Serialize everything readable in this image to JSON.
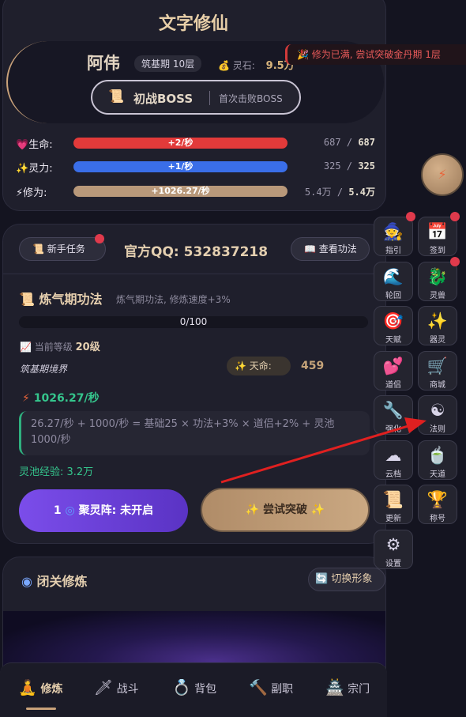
{
  "app_title": "文字修仙",
  "player": {
    "name": "阿伟",
    "realm": "筑基期 10层",
    "spirit_stone_label": "灵石:",
    "spirit_stone_value": "9.5万"
  },
  "boss_button": {
    "label": "初战BOSS",
    "desc": "首次击败BOSS"
  },
  "stats": [
    {
      "icon": "heart-icon",
      "label": "生命:",
      "rate": "+2/秒",
      "current": "687",
      "sep": "/",
      "max": "687",
      "color": "#e23a3a",
      "fill": 1.0
    },
    {
      "icon": "sparkle-icon",
      "label": "灵力:",
      "rate": "+1/秒",
      "current": "325",
      "sep": "/",
      "max": "325",
      "color": "#3a6ee8",
      "fill": 1.0
    },
    {
      "icon": "lightning-icon",
      "label": "修为:",
      "rate": "+1026.27/秒",
      "current": "5.4万",
      "sep": "/",
      "max": "5.4万",
      "color": "#b8987a",
      "fill": 1.0
    }
  ],
  "main": {
    "newbie_task": "新手任务",
    "qq_label": "官方QQ:",
    "qq_number": "532837218",
    "view_method": "查看功法",
    "method_title": "炼气期功法",
    "method_sub": "炼气期功法, 修炼速度+3%",
    "exp_text": "0/100",
    "current_level_label": "当前等级",
    "current_level_value": "20级",
    "realm_state": "筑基期境界",
    "fate_label": "天命:",
    "fate_value": "459",
    "speed": "1026.27/秒",
    "formula": "26.27/秒 + 1000/秒 = 基础25 × 功法+3% × 道侣+2% + 灵池1000/秒",
    "pool_exp": "灵池经验: 3.2万",
    "gather_count": "1",
    "gather_label": "聚灵阵: 未开启",
    "breakthrough_label": "尝试突破"
  },
  "seclusion": {
    "title": "闭关修炼",
    "swap_label": "切换形象"
  },
  "notice": "修为已满, 尝试突破金丹期 1层",
  "side_buttons": [
    {
      "label": "指引",
      "icon": "guide-icon",
      "glyph": "🧙",
      "dot": true
    },
    {
      "label": "签到",
      "icon": "calendar-icon",
      "glyph": "📅",
      "dot": true
    },
    {
      "label": "轮回",
      "icon": "reincarnation-icon",
      "glyph": "🌊",
      "dot": false
    },
    {
      "label": "灵兽",
      "icon": "dragon-icon",
      "glyph": "🐉",
      "dot": true
    },
    {
      "label": "天赋",
      "icon": "target-icon",
      "glyph": "🎯",
      "dot": false
    },
    {
      "label": "器灵",
      "icon": "star-icon",
      "glyph": "✨",
      "dot": false
    },
    {
      "label": "道侣",
      "icon": "hearts-icon",
      "glyph": "💕",
      "dot": false
    },
    {
      "label": "商城",
      "icon": "cart-icon",
      "glyph": "🛒",
      "dot": false
    },
    {
      "label": "强化",
      "icon": "wrench-icon",
      "glyph": "🔧",
      "dot": false
    },
    {
      "label": "法则",
      "icon": "yin-yang-icon",
      "glyph": "☯",
      "dot": false
    },
    {
      "label": "云档",
      "icon": "cloud-icon",
      "glyph": "☁",
      "dot": false
    },
    {
      "label": "天道",
      "icon": "tea-icon",
      "glyph": "🍵",
      "dot": false
    },
    {
      "label": "更新",
      "icon": "scroll-icon",
      "glyph": "📜",
      "dot": false
    },
    {
      "label": "称号",
      "icon": "trophy-icon",
      "glyph": "🏆",
      "dot": false
    },
    {
      "label": "设置",
      "icon": "gear-icon",
      "glyph": "⚙",
      "dot": false
    }
  ],
  "bottom_nav": [
    {
      "label": "修炼",
      "icon": "meditate-icon",
      "glyph": "🧘",
      "active": true
    },
    {
      "label": "战斗",
      "icon": "sword-icon",
      "glyph": "🗡",
      "active": false
    },
    {
      "label": "背包",
      "icon": "ring-icon",
      "glyph": "💍",
      "active": false
    },
    {
      "label": "副职",
      "icon": "hammer-icon",
      "glyph": "🔨",
      "active": false
    },
    {
      "label": "宗门",
      "icon": "pagoda-icon",
      "glyph": "🏯",
      "active": false
    }
  ]
}
